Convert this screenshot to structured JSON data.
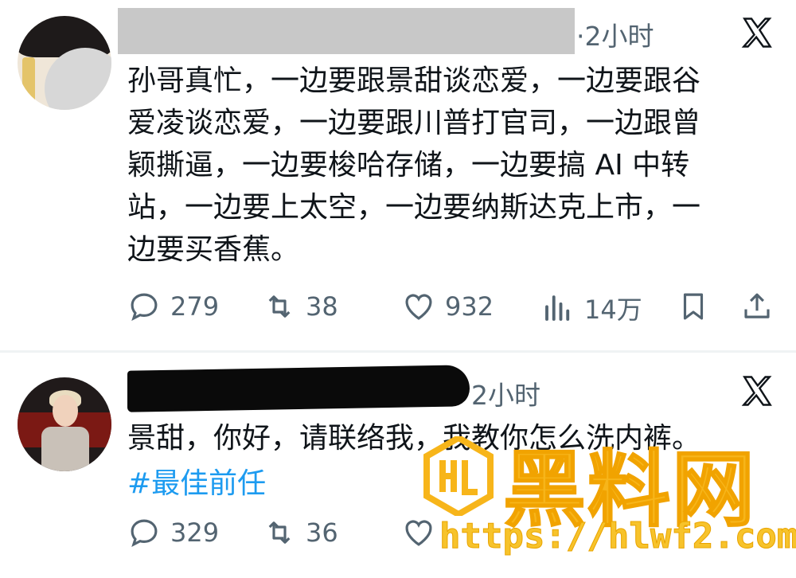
{
  "posts": [
    {
      "time": "·2小时",
      "text_lines": [
        "孙哥真忙，一边要跟景甜谈恋爱，一边要跟谷",
        "爱凌谈恋爱，一边要跟川普打官司，一边跟曾",
        "颖撕逼，一边要梭哈存储，一边要搞 AI 中转",
        "站，一边要上太空，一边要纳斯达克上市，一",
        "边要买香蕉。"
      ],
      "replies": "279",
      "reposts": "38",
      "likes": "932",
      "views": "14万"
    },
    {
      "time": "2小时",
      "text": "景甜，你好，请联络我，我教你怎么洗内裤。",
      "hashtag": "#最佳前任",
      "replies": "329",
      "reposts": "36"
    }
  ],
  "watermark": {
    "title": "黑料网",
    "url": "https://hlwf2.com"
  },
  "icons": {
    "reply": "reply-icon",
    "repost": "repost-icon",
    "like": "like-icon",
    "views": "views-icon",
    "bookmark": "bookmark-icon",
    "share": "share-icon",
    "x": "x-logo-icon"
  },
  "colors": {
    "text": "#0f1419",
    "secondary": "#536471",
    "link": "#1d9bf0",
    "watermark": "#f7b51a"
  }
}
